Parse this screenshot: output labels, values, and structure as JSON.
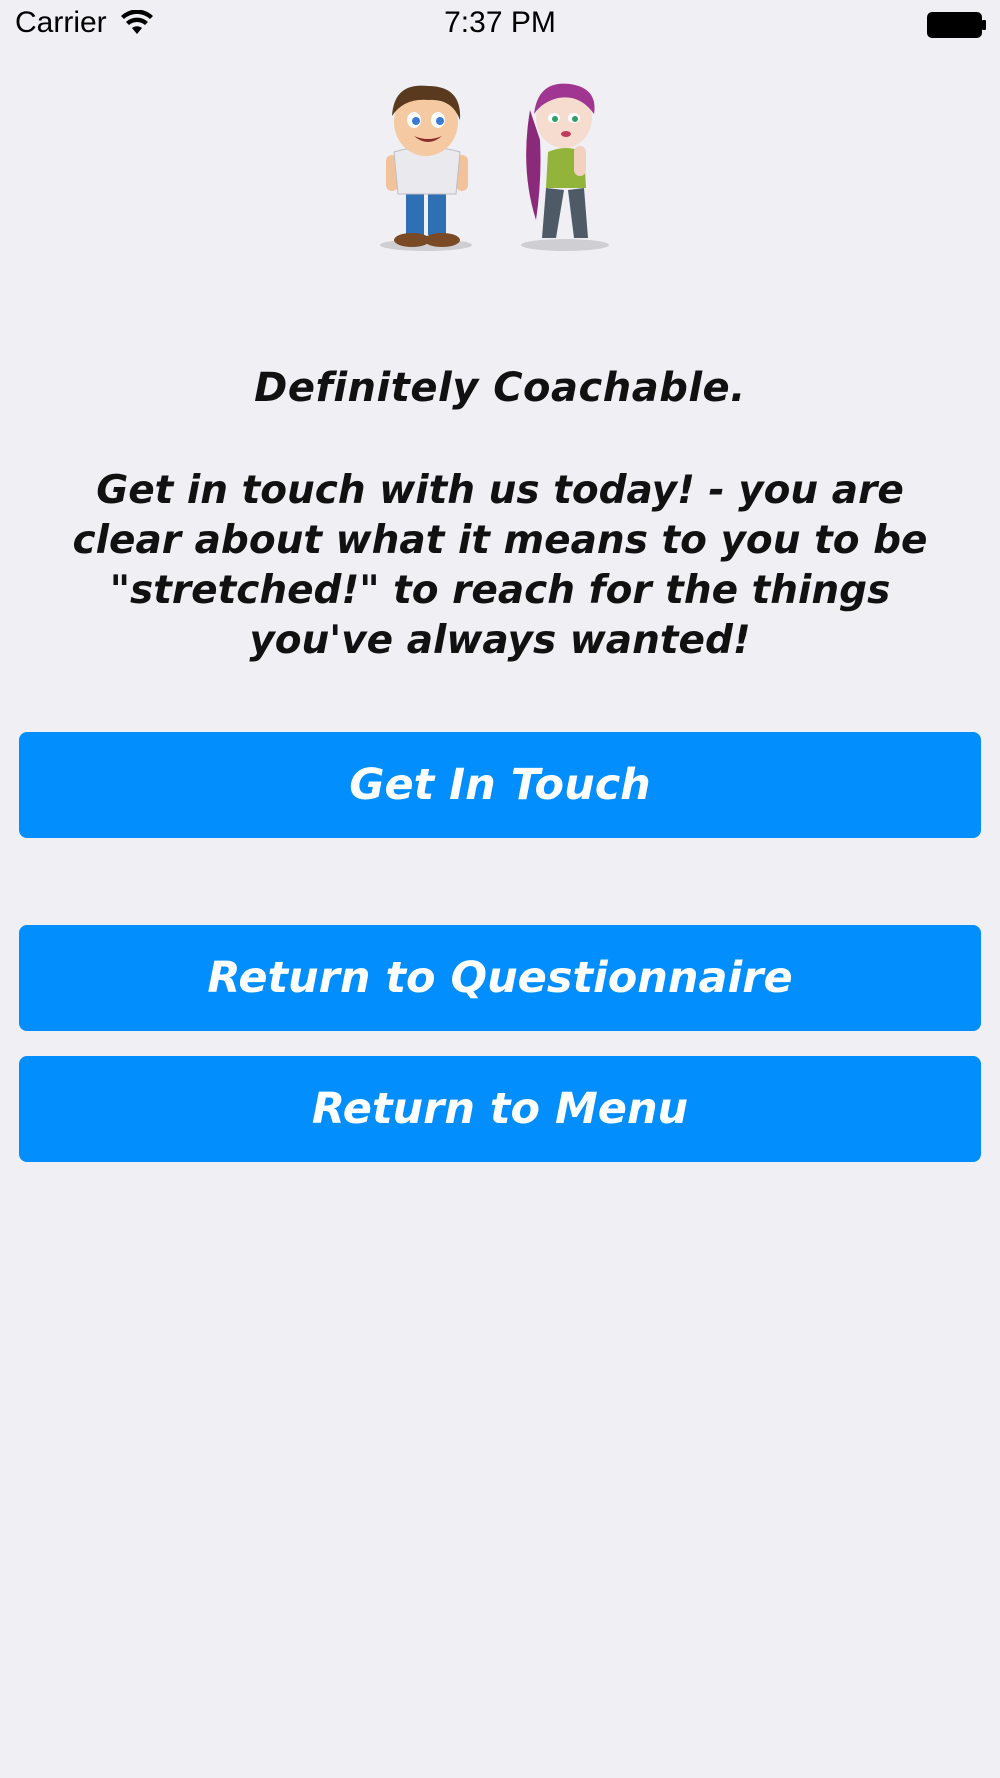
{
  "status_bar": {
    "carrier": "Carrier",
    "time": "7:37 PM",
    "wifi_icon": "wifi-icon",
    "battery_icon": "battery-icon"
  },
  "illustration": {
    "boy_icon": "cartoon-boy-icon",
    "girl_icon": "cartoon-girl-icon"
  },
  "result": {
    "title": "Definitely Coachable.",
    "message": "Get in touch with us today! - you are clear about what it means to you to be \"stretched!\" to reach for the things you've always wanted!"
  },
  "buttons": {
    "get_in_touch": "Get In Touch",
    "return_questionnaire": "Return to Questionnaire",
    "return_menu": "Return to Menu"
  },
  "colors": {
    "background": "#efeff4",
    "button": "#038efd",
    "button_text": "#ffffff"
  }
}
